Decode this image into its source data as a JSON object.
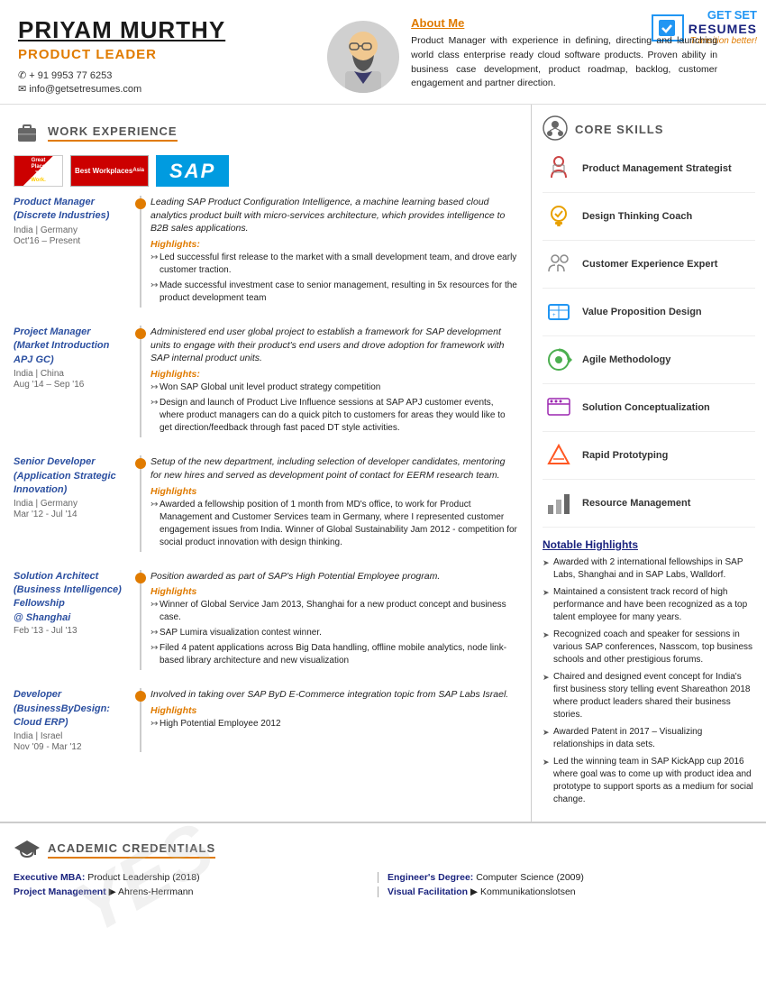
{
  "logo": {
    "get": "GET",
    "set": "SET",
    "resumes": "RESUMES",
    "tagline": "Transition better!"
  },
  "header": {
    "name": "PRIYAM MURTHY",
    "title": "PRODUCT LEADER",
    "phone": "✆ + 91 9953 77 6253",
    "email": "✉ info@getsetresumes.com",
    "about_title": "About Me",
    "about_text": "Product Manager with experience in defining, directing and launching world class enterprise ready cloud software products. Proven ability in business case development, product roadmap, backlog, customer engagement and partner direction."
  },
  "work_section_title": "WORK EXPERIENCE",
  "jobs": [
    {
      "title": "Product Manager\n(Discrete Industries)",
      "location": "India | Germany",
      "date": "Oct'16 – Present",
      "desc": "Leading SAP Product Configuration Intelligence, a machine learning based cloud analytics product built with micro-services architecture, which provides intelligence to B2B sales applications.",
      "highlights": [
        "Led successful first release to the market with a small development team, and drove early customer traction.",
        "Made successful investment case to senior management, resulting in 5x resources for the product development team"
      ]
    },
    {
      "title": "Project Manager\n(Market Introduction\nAPJ GC)",
      "location": "India | China",
      "date": "Aug '14 – Sep '16",
      "desc": "Administered end user global project to establish a framework for SAP development units to engage with their product's end users and drove adoption for framework with SAP internal product units.",
      "highlights": [
        "Won SAP Global unit level product strategy competition",
        "Design and launch of Product Live Influence sessions at SAP APJ customer events, where product managers can do a quick pitch to customers for areas they would like to get direction/feedback through fast paced DT style activities."
      ]
    },
    {
      "title": "Senior Developer\n(Application Strategic\nInnovation)",
      "location": "India | Germany",
      "date": "Mar '12 - Jul '14",
      "desc": "Setup of the new department, including selection of developer candidates, mentoring for new hires and served as development point of contact for EERM research team.",
      "highlights": [
        "Awarded a fellowship position of 1 month from MD's office, to work for Product Management and Customer Services team in Germany, where I represented customer engagement issues from India. Winner of Global Sustainability Jam 2012 - competition for social product innovation with design thinking."
      ]
    },
    {
      "title": "Solution Architect\n(Business Intelligence)\nFellowship\n@ Shanghai",
      "location": "Feb '13 - Jul '13",
      "date": "",
      "desc": "Position awarded as part of SAP's High Potential Employee program.",
      "highlights": [
        "Winner of Global Service Jam 2013, Shanghai for a new product concept and business case.",
        "SAP Lumira visualization contest winner.",
        "Filed 4 patent applications across Big Data handling, offline mobile analytics, node link-based library architecture and new visualization"
      ]
    },
    {
      "title": "Developer\n(BusinessByDesign:\nCloud ERP)",
      "location": "India | Israel",
      "date": "Nov '09 - Mar '12",
      "desc": "Involved in taking over SAP ByD E-Commerce integration topic from SAP Labs Israel.",
      "highlights": [
        "High Potential Employee 2012"
      ]
    }
  ],
  "core_skills_title": "CORE SKILLS",
  "skills": [
    "Product Management Strategist",
    "Design Thinking Coach",
    "Customer Experience Expert",
    "Value Proposition Design",
    "Agile Methodology",
    "Solution Conceptualization",
    "Rapid Prototyping",
    "Resource Management"
  ],
  "notable_title": "Notable Highlights",
  "notable_items": [
    "Awarded with 2 international fellowships in SAP Labs, Shanghai and in SAP Labs, Walldorf.",
    "Maintained a consistent track record of high performance and have been recognized as a top talent employee for many years.",
    "Recognized coach and speaker for sessions in various SAP conferences, Nasscom, top business schools and other prestigious forums.",
    "Chaired and designed event concept for India's first business story telling event Shareathon 2018 where product leaders shared their business stories.",
    "Awarded Patent in 2017 – Visualizing relationships in data sets.",
    "Led the winning team in SAP KickApp cup 2016 where goal was to come up with product idea and prototype to support sports as a medium for social change."
  ],
  "academic_title": "ACADEMIC CREDENTIALS",
  "academics": [
    {
      "label": "Executive MBA:",
      "value": "Product Leadership (2018)"
    },
    {
      "label": "Engineer's Degree:",
      "value": "Computer Science (2009)"
    },
    {
      "label": "Project Management",
      "value": "▶ Ahrens-Herrmann"
    },
    {
      "label": "Visual Facilitation",
      "value": "▶ Kommunikationslotsen"
    }
  ],
  "watermark": "YES"
}
